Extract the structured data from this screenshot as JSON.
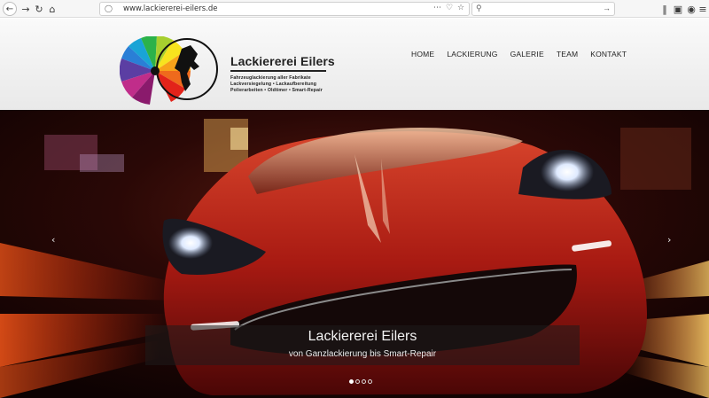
{
  "browser": {
    "url": "www.lackiererei-eilers.de",
    "icons": [
      "back-icon",
      "forward-icon",
      "reload-icon",
      "home-icon",
      "shield-icon",
      "more-icon",
      "pocket-icon",
      "bookmark-star-icon",
      "search-icon",
      "arrow-right-icon",
      "library-icon",
      "sidebar-icon",
      "sync-icon",
      "menu-icon"
    ]
  },
  "logo": {
    "title": "Lackiererei Eilers",
    "line1": "Fahrzeuglackierung aller Fabrikate",
    "line2": "Lackversiegelung • Lackaufbereitung",
    "line3": "Polierarbeiten • Oldtimer • Smart-Repair"
  },
  "nav": {
    "items": [
      "HOME",
      "LACKIERUNG",
      "GALERIE",
      "TEAM",
      "KONTAKT"
    ]
  },
  "hero": {
    "title": "Lackiererei Eilers",
    "subtitle": "von Ganzlackierung bis Smart-Repair",
    "slides": 4,
    "active_slide": 1
  },
  "colors": {
    "accent_red": "#c1281a",
    "header_bg": "#f0f0f0"
  }
}
